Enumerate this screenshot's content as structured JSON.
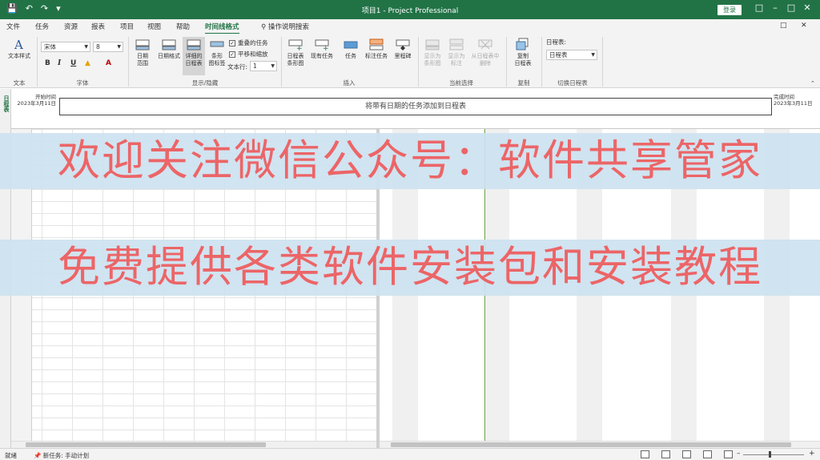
{
  "window": {
    "title": "项目1 - Project Professional",
    "login_label": "登录",
    "quick_access": [
      "save-icon",
      "undo-icon",
      "redo-icon",
      "customize-icon"
    ]
  },
  "menu": {
    "tabs": [
      "文件",
      "任务",
      "资源",
      "报表",
      "项目",
      "视图",
      "帮助",
      "时间线格式"
    ],
    "active_tab": "时间线格式",
    "search_label": "操作说明搜索"
  },
  "ribbon": {
    "groups": {
      "text": {
        "label": "文本",
        "text_styles": "文本样式"
      },
      "font": {
        "label": "字体",
        "font_name": "宋体",
        "font_size": "8",
        "bold": "B",
        "italic": "I",
        "underline": "U",
        "font_color_glyph": "A"
      },
      "show_hide": {
        "label": "显示/隐藏",
        "date_range": "日期\n范围",
        "date_format": "日期格式",
        "detailed_timeline": "详细的\n日程表",
        "bar_labels": "条形\n图标签",
        "overlapping_tasks": "重叠的任务",
        "pan_zoom": "平移和缩放",
        "text_lines_label": "文本行:",
        "text_lines_value": "1"
      },
      "insert": {
        "label": "插入",
        "timeline_bar": "日程表\n条形图",
        "existing_tasks": "现有任务",
        "task": "任务",
        "callout_task": "标注任务",
        "milestone": "里程碑"
      },
      "current_selection": {
        "label": "当前选择",
        "display_as_bar": "显示为\n条形图",
        "display_as_callout": "显示为\n标注",
        "remove_from_timeline": "从日程表中\n删除"
      },
      "copy": {
        "label": "复制",
        "copy_timeline": "复制\n日程表"
      },
      "switch_timeline": {
        "label": "切换日程表",
        "field_label": "日程表:",
        "field_value": "日程表"
      }
    }
  },
  "timeline": {
    "side_label": "日程表",
    "start_title": "开始时间",
    "start_date": "2023年3月11日",
    "finish_title": "完成时间",
    "finish_date": "2023年3月11日",
    "placeholder": "将带有日期的任务添加到日程表"
  },
  "watermarks": {
    "line1": "欢迎关注微信公众号：软件共享管家",
    "line2": "免费提供各类软件安装包和安装教程"
  },
  "statusbar": {
    "ready": "就绪",
    "new_tasks": "新任务: 手动计划"
  },
  "colors": {
    "accent": "#217346",
    "watermark_text": "#ec6567",
    "watermark_bg": "#cde2f0"
  }
}
